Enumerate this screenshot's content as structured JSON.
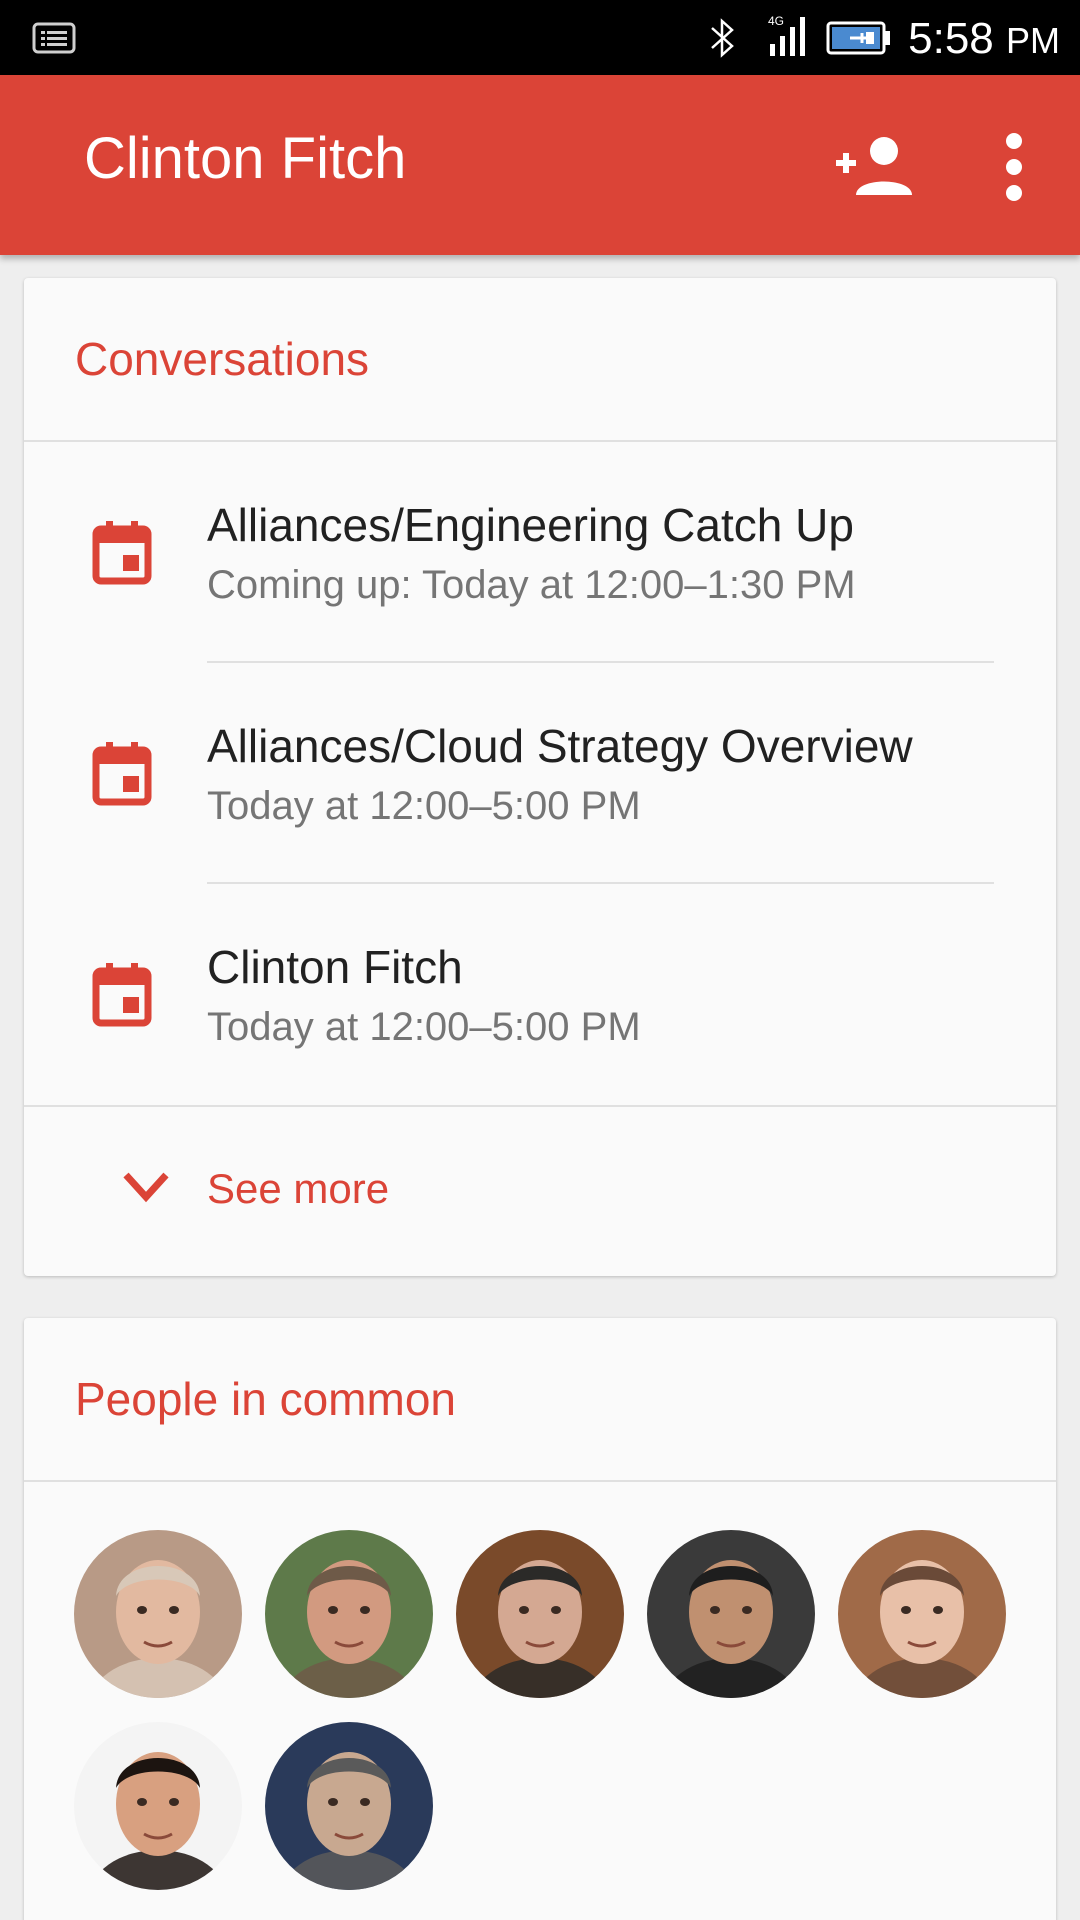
{
  "status_bar": {
    "network": "4G",
    "time": "5:58",
    "ampm": "PM",
    "icons": [
      "notification-icon",
      "bluetooth-icon",
      "signal-icon",
      "battery-charging-icon"
    ]
  },
  "app_bar": {
    "title": "Clinton Fitch",
    "color": "#db4437",
    "actions": [
      "add-person-icon",
      "more-vert-icon"
    ]
  },
  "conversations": {
    "title": "Conversations",
    "items": [
      {
        "title": "Alliances/Engineering Catch Up",
        "time": "Coming up: Today at 12:00–1:30 PM",
        "icon": "calendar-icon"
      },
      {
        "title": "Alliances/Cloud Strategy Overview",
        "time": "Today at 12:00–5:00 PM",
        "icon": "calendar-icon"
      },
      {
        "title": "Clinton Fitch",
        "time": "Today at 12:00–5:00 PM",
        "icon": "calendar-icon"
      }
    ],
    "see_more": "See more"
  },
  "people_in_common": {
    "title": "People in common",
    "avatars": [
      {
        "bg": "#b89a86",
        "skin": "#e2b9a0",
        "hair": "#d8c8b8"
      },
      {
        "bg": "#5e7a4a",
        "skin": "#d29a80",
        "hair": "#6e5a48"
      },
      {
        "bg": "#7a4a2a",
        "skin": "#d4a892",
        "hair": "#2b2a28"
      },
      {
        "bg": "#3a3a3a",
        "skin": "#c09070",
        "hair": "#1e1e1e"
      },
      {
        "bg": "#a06a48",
        "skin": "#e8c0a8",
        "hair": "#6a4a38"
      },
      {
        "bg": "#f4f4f4",
        "skin": "#d8a080",
        "hair": "#1c1410"
      },
      {
        "bg": "#2a3a5a",
        "skin": "#c8a890",
        "hair": "#5a5a5a"
      }
    ]
  }
}
